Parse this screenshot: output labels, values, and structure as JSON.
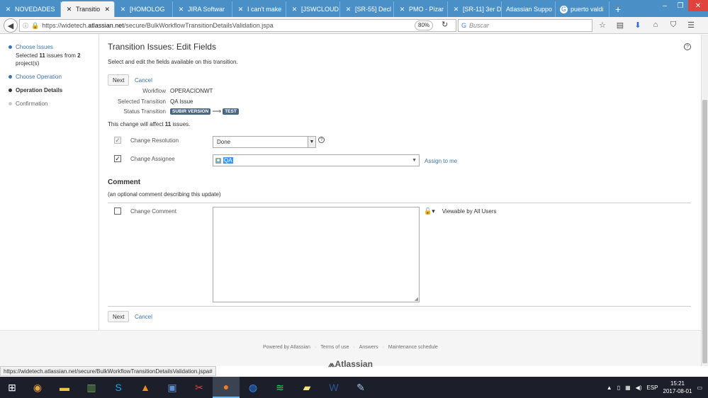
{
  "browser": {
    "tabs": [
      {
        "label": "NOVEDADES",
        "icon": "jira-icon",
        "active": false
      },
      {
        "label": "Transitio",
        "icon": "jira-icon",
        "active": true
      },
      {
        "label": "[HOMOLOG",
        "icon": "jira-icon",
        "active": false
      },
      {
        "label": "JIRA Softwar",
        "icon": "jira-icon",
        "active": false
      },
      {
        "label": "I can't make",
        "icon": "jira-icon",
        "active": false
      },
      {
        "label": "[JSWCLOUD",
        "icon": "jira-icon",
        "active": false
      },
      {
        "label": "[SR-55] Decl",
        "icon": "jira-icon",
        "active": false
      },
      {
        "label": "PMO - Pizar",
        "icon": "jira-icon",
        "active": false
      },
      {
        "label": "[SR-11] 3er D",
        "icon": "jira-icon",
        "active": false
      },
      {
        "label": "Atlassian Suppo",
        "icon": "",
        "active": false
      },
      {
        "label": "puerto valdi",
        "icon": "google-icon",
        "active": false
      }
    ],
    "url_prefix": "https://widetech.",
    "url_host": "atlassian.net",
    "url_path": "/secure/BulkWorkflowTransitionDetailsValidation.jspa",
    "zoom": "80%",
    "search_placeholder": "Buscar"
  },
  "sidebar": {
    "steps": [
      {
        "label": "Choose Issues",
        "state": "done",
        "sub_prefix": "Selected ",
        "sub_count": "11",
        "sub_mid": " issues from ",
        "sub_projects": "2",
        "sub_suffix": "project(s)"
      },
      {
        "label": "Choose Operation",
        "state": "done"
      },
      {
        "label": "Operation Details",
        "state": "current"
      },
      {
        "label": "Confirmation",
        "state": "todo"
      }
    ]
  },
  "main": {
    "title": "Transition Issues: Edit Fields",
    "description": "Select and edit the fields available on this transition.",
    "next_label": "Next",
    "cancel_label": "Cancel",
    "workflow_label": "Workflow",
    "workflow_value": "OPERACIONWT",
    "selected_transition_label": "Selected Transition",
    "selected_transition_value": "QA Issue",
    "status_transition_label": "Status Transition",
    "status_from": "SUBIR VERSION",
    "status_to": "TEST",
    "affect_prefix": "This change will affect ",
    "affect_count": "11",
    "affect_suffix": " issues.",
    "resolution_label": "Change Resolution",
    "resolution_value": "Done",
    "assignee_label": "Change Assignee",
    "assignee_value": "QA",
    "assign_to_me": "Assign to me",
    "comment_heading": "Comment",
    "comment_sub": "(an optional comment describing this update)",
    "change_comment_label": "Change Comment",
    "viewable_label": "Viewable by All Users"
  },
  "footer": {
    "links": [
      "Powered by Atlassian",
      "Terms of use",
      "Answers",
      "Maintenance schedule"
    ],
    "brand": "Atlassian"
  },
  "status_url": "https://widetech.atlassian.net/secure/BulkWorkflowTransitionDetailsValidation.jspa#",
  "taskbar": {
    "apps": [
      "chrome-icon",
      "file-explorer-icon",
      "project-icon",
      "skype-icon",
      "vlc-icon",
      "remote-desktop-icon",
      "snipping-tool-icon",
      "firefox-icon",
      "zoom-icon",
      "spotify-icon",
      "sticky-notes-icon",
      "word-icon",
      "paint-icon"
    ],
    "language": "ESP",
    "time": "15:21",
    "date": "2017-08-01"
  }
}
